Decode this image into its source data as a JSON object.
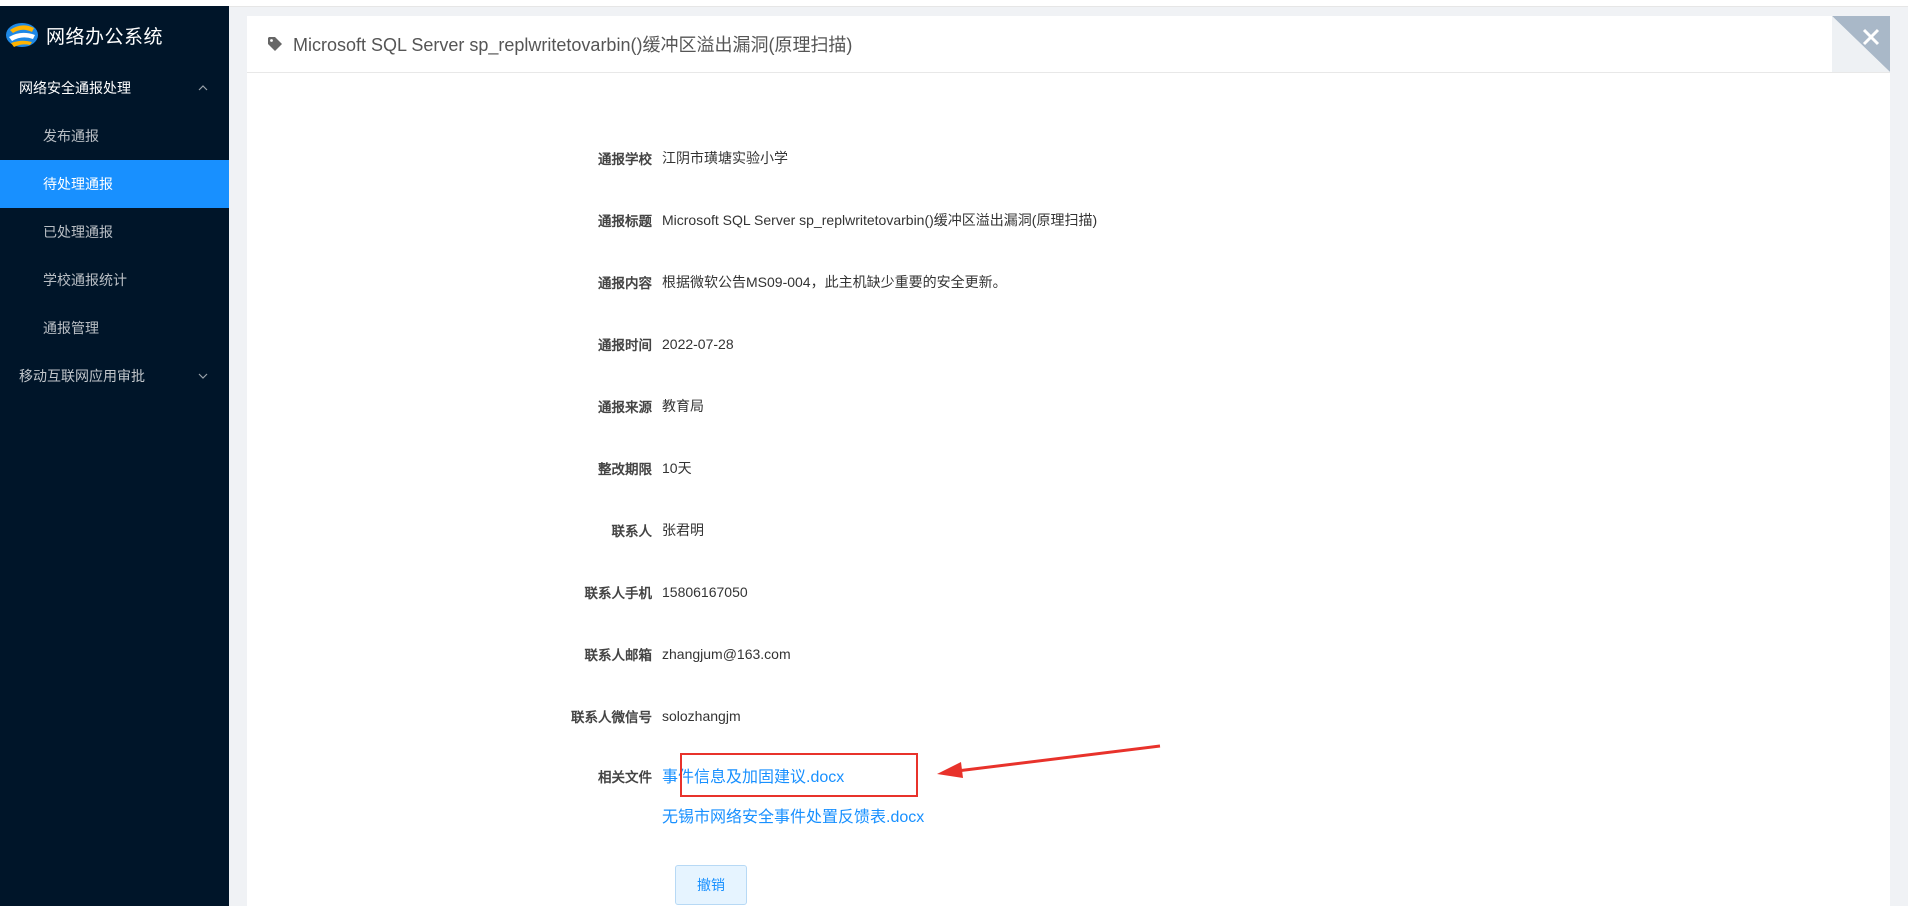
{
  "app": {
    "title": "网络办公系统"
  },
  "sidebar": {
    "groups": [
      {
        "label": "网络安全通报处理"
      },
      {
        "label": "移动互联网应用审批"
      }
    ],
    "items": [
      {
        "label": "发布通报"
      },
      {
        "label": "待处理通报"
      },
      {
        "label": "已处理通报"
      },
      {
        "label": "学校通报统计"
      },
      {
        "label": "通报管理"
      }
    ],
    "active_index": 1
  },
  "panel": {
    "title": "Microsoft SQL Server sp_replwritetovarbin()缓冲区溢出漏洞(原理扫描)",
    "fields": [
      {
        "label": "通报学校",
        "value": "江阴市璜塘实验小学"
      },
      {
        "label": "通报标题",
        "value": "Microsoft SQL Server sp_replwritetovarbin()缓冲区溢出漏洞(原理扫描)"
      },
      {
        "label": "通报内容",
        "value": "根据微软公告MS09-004，此主机缺少重要的安全更新。"
      },
      {
        "label": "通报时间",
        "value": "2022-07-28"
      },
      {
        "label": "通报来源",
        "value": "教育局"
      },
      {
        "label": "整改期限",
        "value": "10天"
      },
      {
        "label": "联系人",
        "value": "张君明"
      },
      {
        "label": "联系人手机",
        "value": "15806167050"
      },
      {
        "label": "联系人邮箱",
        "value": "zhangjum@163.com"
      },
      {
        "label": "联系人微信号",
        "value": "solozhangjm"
      }
    ],
    "files_label": "相关文件",
    "files": [
      "事件信息及加固建议.docx",
      "无锡市网络安全事件处置反馈表.docx"
    ],
    "cancel_label": "撤销"
  },
  "colors": {
    "sidebar_bg": "#001529",
    "accent": "#1890ff",
    "annotation": "#e8322b"
  },
  "icons": [
    "logo-icon",
    "chevron-up-icon",
    "chevron-down-icon",
    "tag-icon",
    "close-icon",
    "annotation-arrow"
  ]
}
